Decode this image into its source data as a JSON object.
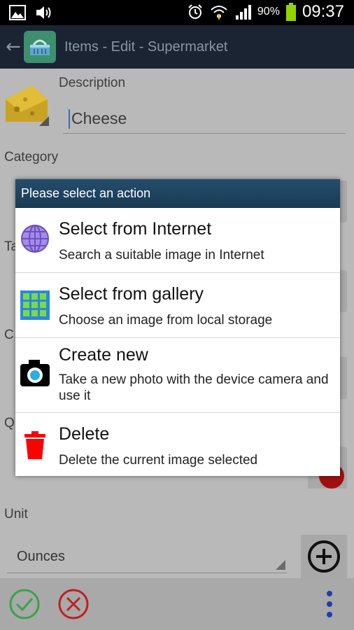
{
  "status_bar": {
    "battery_percent": "90%",
    "time": "09:37",
    "icons": [
      "image-icon",
      "volume-icon",
      "alarm-icon",
      "wifi-icon",
      "signal-icon",
      "battery-icon"
    ]
  },
  "action_bar": {
    "title": "Items - Edit - Supermarket",
    "icons": [
      "back-arrow-icon",
      "basket-icon"
    ]
  },
  "form": {
    "description_label": "Description",
    "description_value": "Cheese",
    "category_label": "Category",
    "partial_labels": [
      "Ta",
      "C",
      "Q"
    ],
    "unit_label": "Unit",
    "unit_value": "Ounces"
  },
  "dialog": {
    "header": "Please select an action",
    "options": [
      {
        "title": "Select from Internet",
        "subtitle": "Search a suitable image in Internet",
        "icon": "globe-icon"
      },
      {
        "title": "Select from gallery",
        "subtitle": "Choose an image from local storage",
        "icon": "grid-icon"
      },
      {
        "title": "Create new",
        "subtitle": "Take a new photo with the device camera and use it",
        "icon": "camera-icon"
      },
      {
        "title": "Delete",
        "subtitle": "Delete the current image selected",
        "icon": "trash-icon"
      }
    ]
  },
  "bottom_bar": {
    "icons": [
      "check-icon",
      "cancel-icon",
      "overflow-menu-icon"
    ]
  },
  "colors": {
    "accent_green": "#3aa34a",
    "cancel_red": "#c02020",
    "menu_blue": "#1e3ea8",
    "dialog_header": "#1f4461",
    "delete_red": "#ff0000"
  }
}
